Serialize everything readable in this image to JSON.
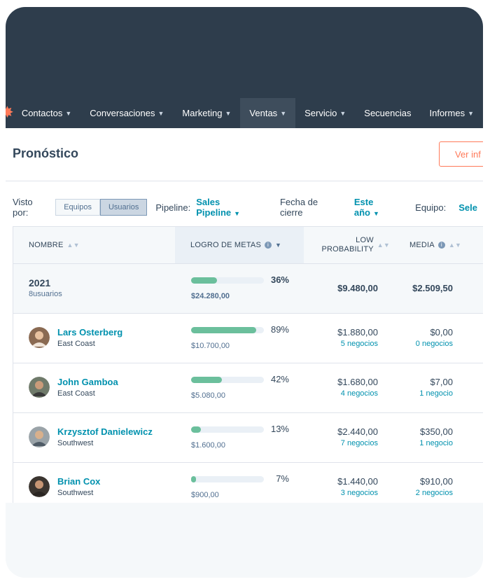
{
  "nav": {
    "items": [
      {
        "label": "Contactos",
        "active": false
      },
      {
        "label": "Conversaciones",
        "active": false
      },
      {
        "label": "Marketing",
        "active": false
      },
      {
        "label": "Ventas",
        "active": true
      },
      {
        "label": "Servicio",
        "active": false
      },
      {
        "label": "Secuencias",
        "active": false
      },
      {
        "label": "Informes",
        "active": false
      }
    ]
  },
  "header": {
    "title": "Pronóstico",
    "view_button": "Ver inf"
  },
  "filters": {
    "seen_by_label": "Visto por:",
    "toggle_teams": "Equipos",
    "toggle_users": "Usuarios",
    "pipeline_label": "Pipeline:",
    "pipeline_value": "Sales Pipeline",
    "close_date_label": "Fecha de cierre",
    "close_date_value": "Este año",
    "team_label": "Equipo:",
    "team_value": "Sele"
  },
  "table": {
    "columns": {
      "name": "NOMBRE",
      "goal": "LOGRO DE METAS",
      "low": "LOW PROBABILITY",
      "media": "MEDIA"
    },
    "summary": {
      "year": "2021",
      "users": "8usuarios",
      "percent": "36%",
      "progress": 0.36,
      "amount": "$24.280,00",
      "low": "$9.480,00",
      "media": "$2.509,50"
    },
    "rows": [
      {
        "name": "Lars Osterberg",
        "region": "East Coast",
        "percent": "89%",
        "progress": 0.89,
        "amount": "$10.700,00",
        "low": "$1.880,00",
        "low_deals": "5 negocios",
        "media": "$0,00",
        "media_deals": "0 negocios"
      },
      {
        "name": "John Gamboa",
        "region": "East Coast",
        "percent": "42%",
        "progress": 0.42,
        "amount": "$5.080,00",
        "low": "$1.680,00",
        "low_deals": "4 negocios",
        "media": "$7,00",
        "media_deals": "1 negocio"
      },
      {
        "name": "Krzysztof Danielewicz",
        "region": "Southwest",
        "percent": "13%",
        "progress": 0.13,
        "amount": "$1.600,00",
        "low": "$2.440,00",
        "low_deals": "7 negocios",
        "media": "$350,00",
        "media_deals": "1 negocio"
      },
      {
        "name": "Brian Cox",
        "region": "Southwest",
        "percent": "7%",
        "progress": 0.07,
        "amount": "$900,00",
        "low": "$1.440,00",
        "low_deals": "3 negocios",
        "media": "$910,00",
        "media_deals": "2 negocios"
      }
    ]
  },
  "colors": {
    "nav_bg": "#2e3d4c",
    "accent_orange": "#ff7a59",
    "link_teal": "#0091ae",
    "progress_green": "#6bbf9c"
  }
}
